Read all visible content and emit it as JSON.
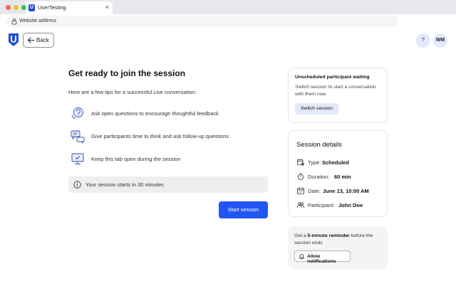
{
  "browser": {
    "tab_title": "UserTesting",
    "tab_close": "×",
    "favicon_letter": "U",
    "address_text": "Website address"
  },
  "header": {
    "back_label": "Back",
    "help_label": "?",
    "avatar_initials": "WM"
  },
  "main": {
    "title": "Get ready to join the session",
    "intro": "Here are a few tips for a successful Live conversation:",
    "tips": [
      {
        "text": "Ask open questions to encourage thoughtful feedback",
        "icon": "chat-question-icon"
      },
      {
        "text": "Give participants time to think and ask follow-up questions",
        "icon": "chat-bubbles-icon"
      },
      {
        "text": "Keep this tab open during the session",
        "icon": "monitor-check-icon"
      }
    ],
    "info_text": "Your session starts in 30 minutes",
    "start_button": "Start session"
  },
  "waiting_card": {
    "title": "Unscheduled participant waiting",
    "description": "Switch session to start a conversation with them now",
    "button": "Switch session"
  },
  "details_card": {
    "title": "Session details",
    "rows": [
      {
        "label": "Type:",
        "value": "Scheduled",
        "icon": "calendar-check-icon"
      },
      {
        "label": "Duration:",
        "value": "60 min",
        "icon": "stopwatch-icon"
      },
      {
        "label": "Date:",
        "value": "June 13, 10:00 AM",
        "icon": "calendar-icon"
      },
      {
        "label": "Participant:",
        "value": "John Doe",
        "icon": "participants-icon"
      }
    ]
  },
  "reminder_card": {
    "text_prefix": "Get a ",
    "text_bold": "5-minute reminder",
    "text_suffix": " before the session ends",
    "button": "Allow notifications"
  },
  "colors": {
    "primary": "#2156f5",
    "brand": "#1f4fd1",
    "soft_blue": "#e3e9fb",
    "info_bg": "#eeeeee"
  }
}
